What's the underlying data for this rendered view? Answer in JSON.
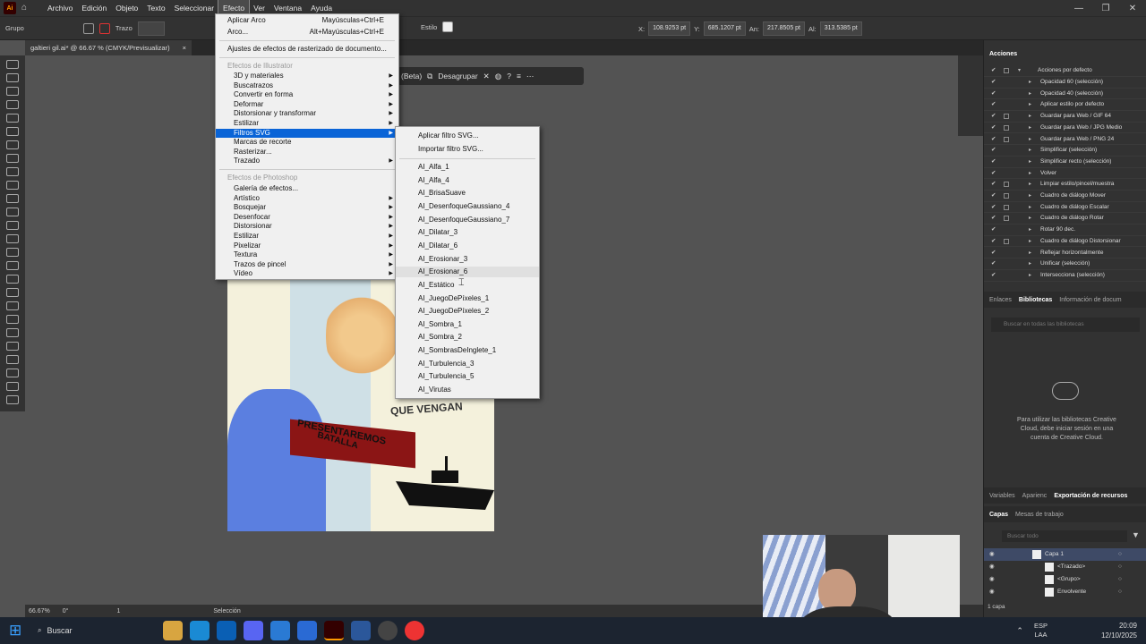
{
  "app": {
    "logo": "Ai",
    "accent": "#ff9a00"
  },
  "menubar": {
    "items": [
      "Archivo",
      "Edición",
      "Objeto",
      "Texto",
      "Seleccionar",
      "Efecto",
      "Ver",
      "Ventana",
      "Ayuda"
    ],
    "active": "Efecto"
  },
  "controlbar": {
    "selection_type": "Grupo",
    "stroke_label": "Trazo",
    "style_label": "Estilo",
    "x_label": "X:",
    "x_value": "108.9253 pt",
    "y_label": "Y:",
    "y_value": "685.1207 pt",
    "w_label": "An:",
    "w_value": "217.8505 pt",
    "h_label": "Al:",
    "h_value": "313.5385 pt"
  },
  "document": {
    "tab_title": "galtieri gil.ai* @ 66.67 % (CMYK/Previsualizar)",
    "close": "×"
  },
  "context_bar": {
    "beta_label": "(Beta)",
    "ungroup_label": "Desagrupar"
  },
  "effect_menu": {
    "apply_last": "Aplicar Arco",
    "apply_last_shortcut": "Mayúsculas+Ctrl+E",
    "last": "Arco...",
    "last_shortcut": "Alt+Mayúsculas+Ctrl+E",
    "raster_settings": "Ajustes de efectos de rasterizado de documento...",
    "illustrator_header": "Efectos de Illustrator",
    "illustrator_items": [
      {
        "label": "3D y materiales",
        "sub": true
      },
      {
        "label": "Buscatrazos",
        "sub": true
      },
      {
        "label": "Convertir en forma",
        "sub": true
      },
      {
        "label": "Deformar",
        "sub": true
      },
      {
        "label": "Distorsionar y transformar",
        "sub": true
      },
      {
        "label": "Estilizar",
        "sub": true
      },
      {
        "label": "Filtros SVG",
        "sub": true,
        "selected": true
      },
      {
        "label": "Marcas de recorte",
        "sub": false
      },
      {
        "label": "Rasterizar...",
        "sub": false
      },
      {
        "label": "Trazado",
        "sub": true
      }
    ],
    "photoshop_header": "Efectos de Photoshop",
    "photoshop_items": [
      {
        "label": "Galería de efectos...",
        "sub": false
      },
      {
        "label": "Artístico",
        "sub": true
      },
      {
        "label": "Bosquejar",
        "sub": true
      },
      {
        "label": "Desenfocar",
        "sub": true
      },
      {
        "label": "Distorsionar",
        "sub": true
      },
      {
        "label": "Estilizar",
        "sub": true
      },
      {
        "label": "Pixelizar",
        "sub": true
      },
      {
        "label": "Textura",
        "sub": true
      },
      {
        "label": "Trazos de pincel",
        "sub": true
      },
      {
        "label": "Vídeo",
        "sub": true
      }
    ]
  },
  "svg_filters_menu": {
    "apply": "Aplicar filtro SVG...",
    "import": "Importar filtro SVG...",
    "filters": [
      "AI_Alfa_1",
      "AI_Alfa_4",
      "AI_BrisaSuave",
      "AI_DesenfoqueGaussiano_4",
      "AI_DesenfoqueGaussiano_7",
      "AI_Dilatar_3",
      "AI_Dilatar_6",
      "AI_Erosionar_3",
      "AI_Erosionar_6",
      "AI_Estático",
      "AI_JuegoDePíxeles_1",
      "AI_JuegoDePíxeles_2",
      "AI_Sombra_1",
      "AI_Sombra_2",
      "AI_SombrasDeInglete_1",
      "AI_Turbulencia_3",
      "AI_Turbulencia_5",
      "AI_Virutas"
    ],
    "hovered": "AI_Erosionar_6"
  },
  "artwork": {
    "text_top": "QUE VENGAN",
    "text_mid": "PRESENTAREMOS",
    "text_mid2": "BATALLA"
  },
  "actions_panel": {
    "title": "Acciones",
    "set_name": "Acciones por defecto",
    "actions": [
      "Opacidad 60 (selección)",
      "Opacidad 40 (selección)",
      "Aplicar estilo por defecto",
      "Guardar para Web / GIF 64",
      "Guardar para Web / JPG Medio",
      "Guardar para Web / PNG 24",
      "Simplificar (selección)",
      "Simplificar recto (selección)",
      "Volver",
      "Limpiar estilo/pincel/muestra",
      "Cuadro de diálogo Mover",
      "Cuadro de diálogo Escalar",
      "Cuadro de diálogo Rotar",
      "Rotar 90 dec.",
      "Cuadro de diálogo Distorsionar",
      "Reflejar horizontalmente",
      "Unificar (selección)",
      "Intersecciona (selección)"
    ]
  },
  "libraries_panel": {
    "tabs": [
      "Enlaces",
      "Bibliotecas",
      "Información de docum"
    ],
    "active": "Bibliotecas",
    "search_placeholder": "Buscar en todas las bibliotecas",
    "message": "Para utilizar las bibliotecas Creative Cloud, debe iniciar sesión en una cuenta de Creative Cloud."
  },
  "middle_tabs": {
    "tabs": [
      "Variables",
      "Aparienc",
      "Exportación de recursos"
    ],
    "active": "Exportación de recursos"
  },
  "layers_panel": {
    "tabs": [
      "Capas",
      "Mesas de trabajo"
    ],
    "active": "Capas",
    "search_placeholder": "Buscar todo",
    "rows": [
      "Capa 1",
      "<Trazado>",
      "<Grupo>",
      "Envolvente"
    ],
    "count": "1 capa"
  },
  "statusbar": {
    "zoom": "66.67%",
    "rotation": "0°",
    "page": "1",
    "tool": "Selección"
  },
  "taskbar": {
    "search_label": "Buscar",
    "lang": "ESP",
    "lang2": "LAA",
    "time": "20:09",
    "date": "12/10/2025"
  }
}
